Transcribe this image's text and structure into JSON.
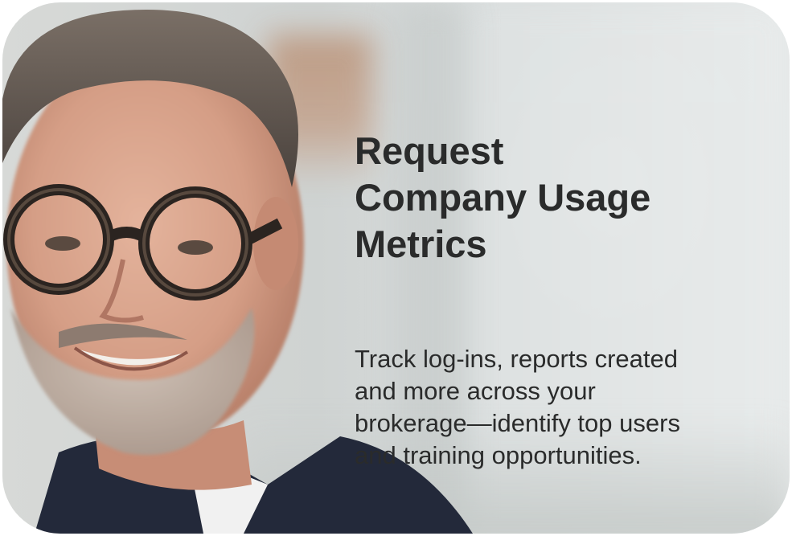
{
  "card": {
    "headline_lines": [
      "Request",
      "Company Usage",
      "Metrics"
    ],
    "description_lines": [
      "Track log-ins, reports created",
      "and more across your",
      "brokerage—identify top users",
      "and training opportunities."
    ],
    "image": "photo of a smiling man with glasses"
  },
  "colors": {
    "text": "#2a2b2b",
    "background": "#d8dcdc"
  }
}
